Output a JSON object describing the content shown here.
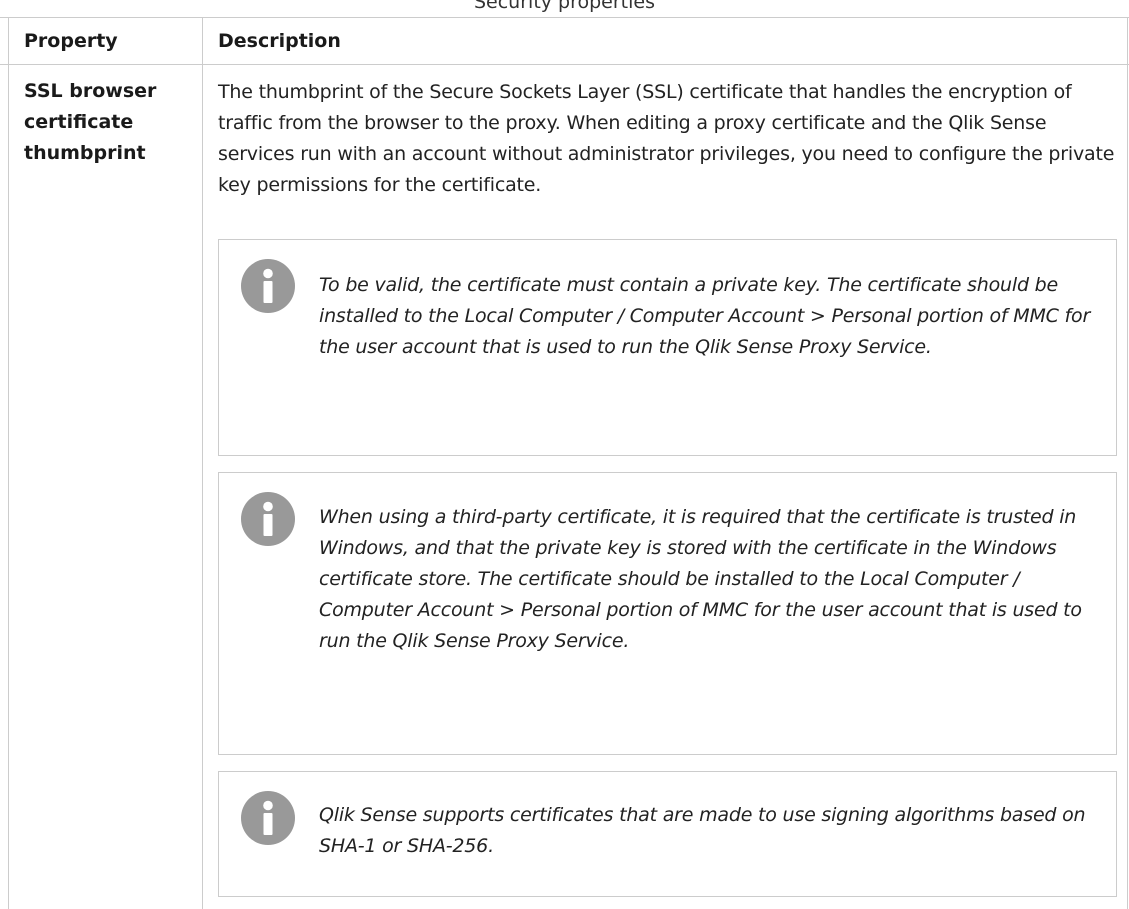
{
  "caption": "Security properties",
  "table": {
    "headers": [
      "Property",
      "Description"
    ],
    "rows": [
      {
        "property": "SSL browser certificate thumbprint",
        "description": "The thumbprint of the Secure Sockets Layer (SSL) certificate that handles the encryption of traffic from the browser to the proxy. When editing a proxy certificate and the Qlik Sense services run with an account without administrator privileges, you need to configure the private key permissions for the certificate.",
        "notes": [
          {
            "icon": "info-icon",
            "text": "To be valid, the certificate must contain a private key. The certificate should be installed to the Local Computer / Computer Account > Personal portion of MMC for the user account that is used to run the Qlik Sense Proxy Service."
          },
          {
            "icon": "info-icon",
            "text": "When using a third-party certificate, it is required that the certificate is trusted in Windows, and that the private key is stored with the certificate in the Windows certificate store. The certificate should be installed to the Local Computer / Computer Account > Personal portion of MMC for the user account that is used to run the Qlik Sense Proxy Service."
          },
          {
            "icon": "info-icon",
            "text": "Qlik Sense supports certificates that are made to use signing algorithms based on SHA-1 or SHA-256."
          }
        ]
      }
    ]
  },
  "colors": {
    "border": "#cccccc",
    "icon": "#999999",
    "text": "#222222"
  }
}
